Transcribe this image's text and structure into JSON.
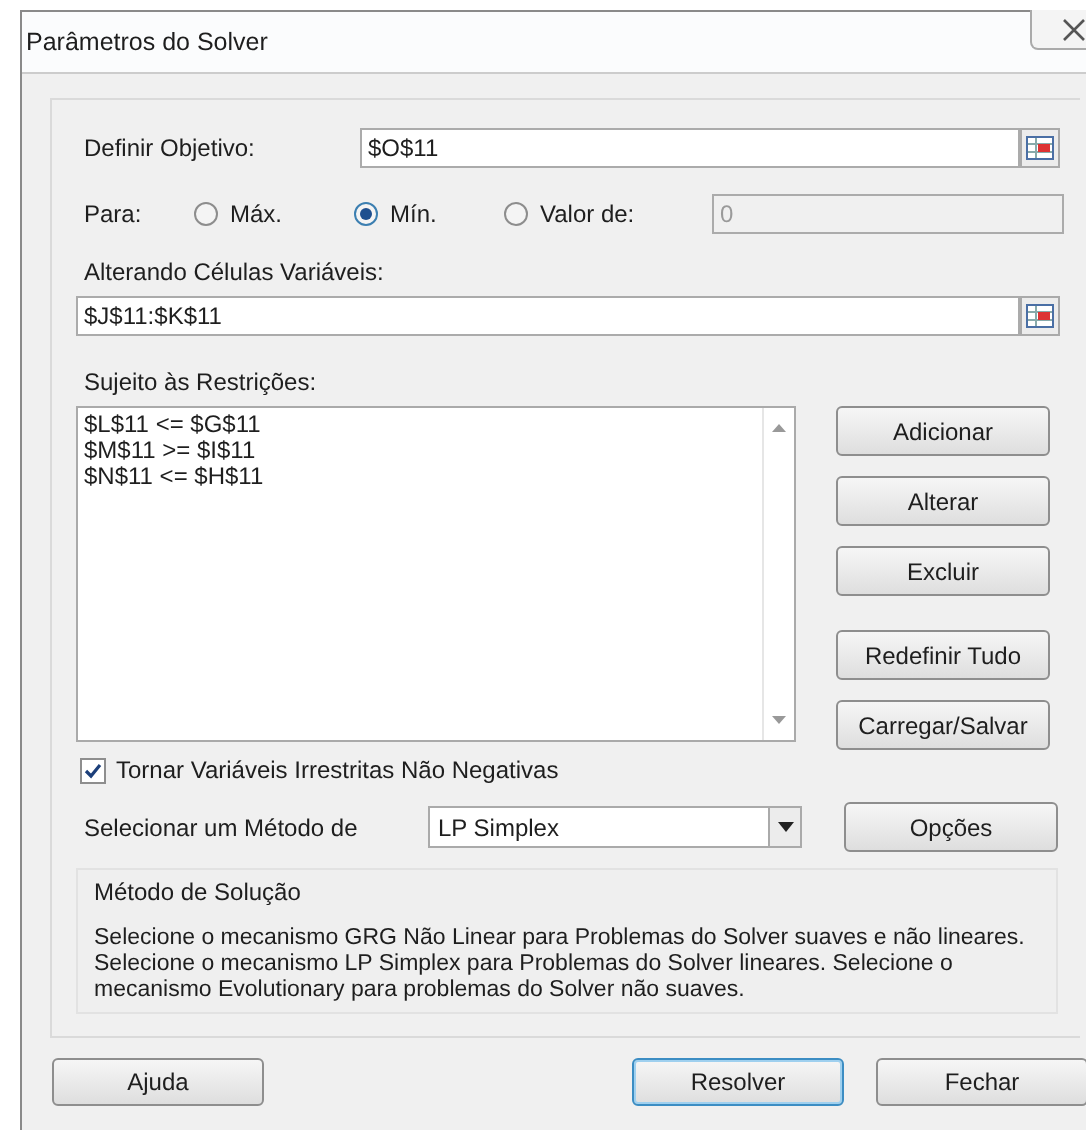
{
  "window": {
    "title": "Parâmetros do Solver"
  },
  "objective": {
    "label": "Definir Objetivo:",
    "value": "$O$11"
  },
  "target": {
    "label": "Para:",
    "options": [
      {
        "label": "Máx.",
        "selected": false
      },
      {
        "label": "Mín.",
        "selected": true
      },
      {
        "label": "Valor de:",
        "selected": false
      }
    ],
    "value_field": {
      "value": "0",
      "disabled": true
    }
  },
  "variables": {
    "label": "Alterando Células Variáveis:",
    "value": "$J$11:$K$11"
  },
  "constraints": {
    "label": "Sujeito às Restrições:",
    "items": [
      "$L$11 <= $G$11",
      "$M$11 >= $I$11",
      "$N$11 <= $H$11"
    ]
  },
  "edit_buttons": [
    "Adicionar",
    "Alterar",
    "Excluir"
  ],
  "file_buttons": [
    "Redefinir Tudo",
    "Carregar/Salvar"
  ],
  "nonnegative": {
    "label": "Tornar Variáveis Irrestritas Não Negativas",
    "checked": true
  },
  "method": {
    "label": "Selecionar um Método de",
    "value": "LP Simplex"
  },
  "options_button": "Opções",
  "solution": {
    "title": "Método de Solução",
    "text": "Selecione o mecanismo GRG Não Linear para Problemas do Solver suaves e não lineares. Selecione o mecanismo LP Simplex para Problemas do Solver lineares. Selecione o mecanismo Evolutionary para problemas do Solver não suaves."
  },
  "footer_buttons": [
    {
      "label": "Ajuda",
      "default": false
    },
    {
      "label": "Resolver",
      "default": true
    },
    {
      "label": "Fechar",
      "default": false
    }
  ]
}
